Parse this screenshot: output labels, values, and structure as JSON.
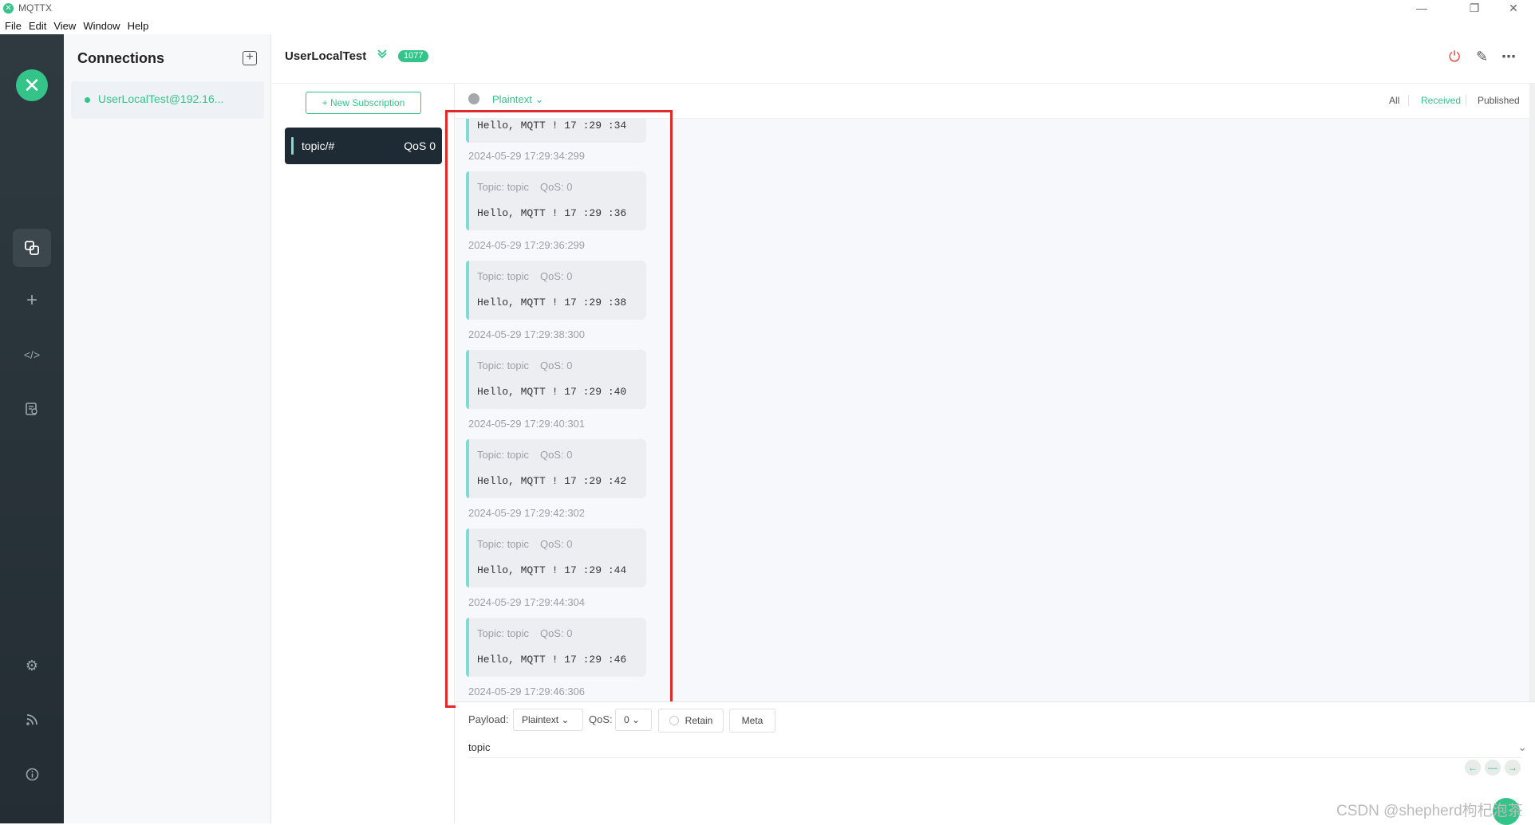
{
  "window": {
    "title": "MQTTX",
    "controls": {
      "minimize": "—",
      "restore": "❐",
      "close": "✕"
    }
  },
  "menu": [
    "File",
    "Edit",
    "View",
    "Window",
    "Help"
  ],
  "rail": {
    "logo": "✕",
    "icons": [
      "connections-icon",
      "add-icon",
      "code-icon",
      "log-icon",
      "settings-icon",
      "feed-icon",
      "info-icon"
    ]
  },
  "connections": {
    "title": "Connections",
    "add_label": "+",
    "items": [
      {
        "name": "UserLocalTest@192.16...",
        "status_color": "#34c388"
      }
    ]
  },
  "header": {
    "title": "UserLocalTest",
    "badge": "1077",
    "icons": {
      "disconnect": "⏻",
      "edit": "✎",
      "more": "⋯"
    }
  },
  "subscriptions": {
    "new_label": "+ New Subscription",
    "items": [
      {
        "topic": "topic/#",
        "qos": "QoS 0"
      }
    ]
  },
  "messages_toolbar": {
    "format": "Plaintext",
    "filters": [
      "All",
      "Received",
      "Published"
    ],
    "active_filter": "Received"
  },
  "messages": {
    "partial_top": {
      "payload": "Hello, MQTT ! 17 :29 :34",
      "time": "2024-05-29 17:29:34:299"
    },
    "items": [
      {
        "topic": "Topic: topic",
        "qos": "QoS: 0",
        "payload": "Hello, MQTT ! 17 :29 :36",
        "time": "2024-05-29 17:29:36:299"
      },
      {
        "topic": "Topic: topic",
        "qos": "QoS: 0",
        "payload": "Hello, MQTT ! 17 :29 :38",
        "time": "2024-05-29 17:29:38:300"
      },
      {
        "topic": "Topic: topic",
        "qos": "QoS: 0",
        "payload": "Hello, MQTT ! 17 :29 :40",
        "time": "2024-05-29 17:29:40:301"
      },
      {
        "topic": "Topic: topic",
        "qos": "QoS: 0",
        "payload": "Hello, MQTT ! 17 :29 :42",
        "time": "2024-05-29 17:29:42:302"
      },
      {
        "topic": "Topic: topic",
        "qos": "QoS: 0",
        "payload": "Hello, MQTT ! 17 :29 :44",
        "time": "2024-05-29 17:29:44:304"
      },
      {
        "topic": "Topic: topic",
        "qos": "QoS: 0",
        "payload": "Hello, MQTT ! 17 :29 :46",
        "time": "2024-05-29 17:29:46:306"
      }
    ]
  },
  "publish": {
    "payload_label": "Payload:",
    "payload_format": "Plaintext",
    "qos_label": "QoS:",
    "qos_value": "0",
    "retain_label": "Retain",
    "meta_label": "Meta",
    "topic_value": "topic",
    "nav": {
      "prev": "←",
      "mid": "—",
      "next": "→"
    }
  },
  "watermark": "CSDN @shepherd枸杞泡茶",
  "colors": {
    "accent": "#34c388",
    "rail_bg": "#2e3a40",
    "highlight": "#e02a2a"
  }
}
